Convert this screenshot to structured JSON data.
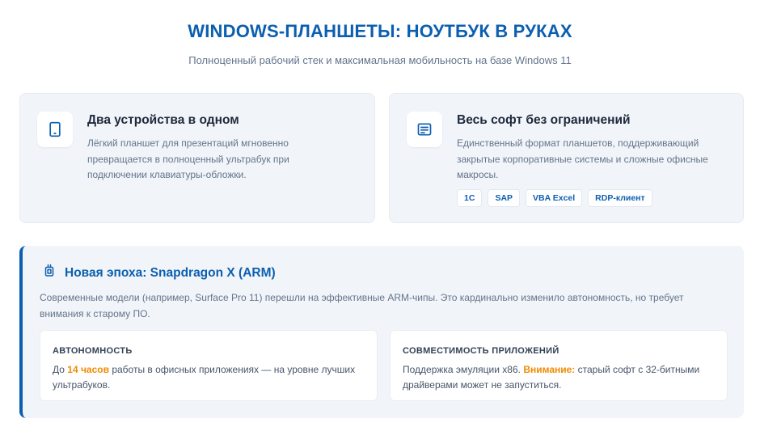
{
  "header": {
    "title": "WINDOWS-ПЛАНШЕТЫ: НОУТБУК В РУКАХ",
    "subtitle": "Полноценный рабочий стек и максимальная мобильность на базе Windows 11"
  },
  "cards": [
    {
      "icon": "tablet-icon",
      "title": "Два устройства в одном",
      "text": "Лёгкий планшет для презентаций мгновенно превращается в полноценный ультрабук при подключении клавиатуры-обложки."
    },
    {
      "icon": "document-text-icon",
      "title": "Весь софт без ограничений",
      "text": "Единственный формат планшетов, поддерживающий закрытые корпоративные системы и сложные офисные макросы.",
      "tags": [
        "1С",
        "SAP",
        "VBA Excel",
        "RDP-клиент"
      ]
    }
  ],
  "panel": {
    "icon": "chip-icon",
    "title": "Новая эпоха: Snapdragon X (ARM)",
    "text": "Современные модели (например, Surface Pro 11) перешли на эффективные ARM-чипы. Это кардинально изменило автономность, но требует внимания к старому ПО.",
    "blocks": [
      {
        "title": "АВТОНОМНОСТЬ",
        "pre": "До ",
        "highlight": "14 часов",
        "post": " работы в офисных приложениях — на уровне лучших ультрабуков."
      },
      {
        "title": "СОВМЕСТИМОСТЬ ПРИЛОЖЕНИЙ",
        "pre": "Поддержка эмуляции x86. ",
        "highlight": "Внимание:",
        "post": " старый софт с 32-битными драйверами может не запуститься."
      }
    ]
  },
  "colors": {
    "accent_blue": "#0b5fb0",
    "accent_orange": "#f08a00",
    "card_bg": "#f1f5f9"
  }
}
